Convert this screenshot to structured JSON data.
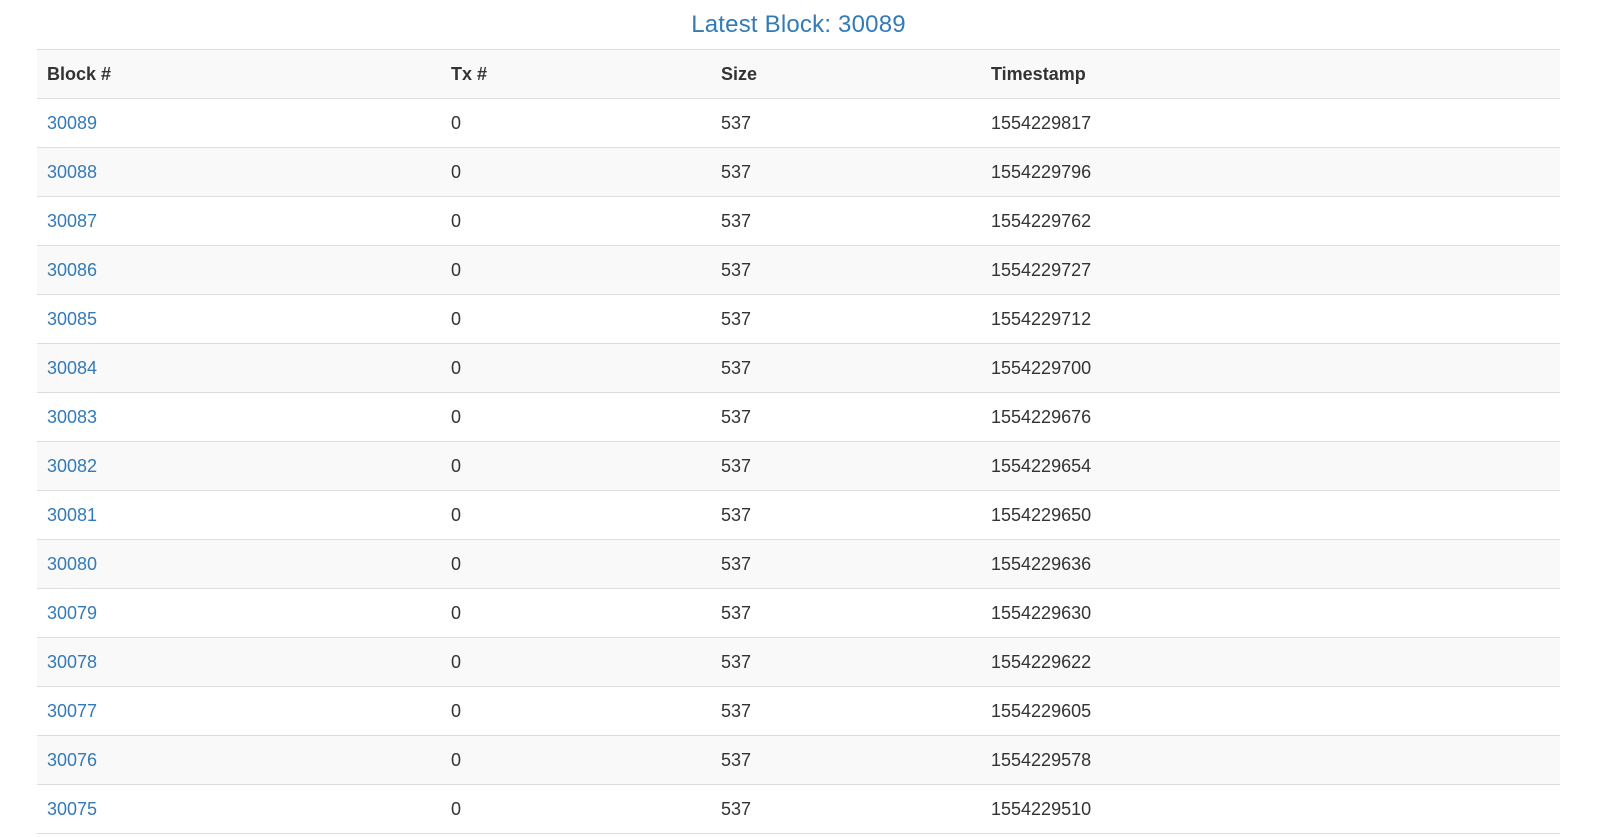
{
  "header": {
    "title": "Latest Block: 30089"
  },
  "colors": {
    "link": "#337ab7",
    "text": "#333333",
    "stripe": "#f9f9f9",
    "border": "#dddddd"
  },
  "table": {
    "columns": [
      "Block #",
      "Tx #",
      "Size",
      "Timestamp"
    ],
    "rows": [
      {
        "block": "30089",
        "tx": "0",
        "size": "537",
        "timestamp": "1554229817"
      },
      {
        "block": "30088",
        "tx": "0",
        "size": "537",
        "timestamp": "1554229796"
      },
      {
        "block": "30087",
        "tx": "0",
        "size": "537",
        "timestamp": "1554229762"
      },
      {
        "block": "30086",
        "tx": "0",
        "size": "537",
        "timestamp": "1554229727"
      },
      {
        "block": "30085",
        "tx": "0",
        "size": "537",
        "timestamp": "1554229712"
      },
      {
        "block": "30084",
        "tx": "0",
        "size": "537",
        "timestamp": "1554229700"
      },
      {
        "block": "30083",
        "tx": "0",
        "size": "537",
        "timestamp": "1554229676"
      },
      {
        "block": "30082",
        "tx": "0",
        "size": "537",
        "timestamp": "1554229654"
      },
      {
        "block": "30081",
        "tx": "0",
        "size": "537",
        "timestamp": "1554229650"
      },
      {
        "block": "30080",
        "tx": "0",
        "size": "537",
        "timestamp": "1554229636"
      },
      {
        "block": "30079",
        "tx": "0",
        "size": "537",
        "timestamp": "1554229630"
      },
      {
        "block": "30078",
        "tx": "0",
        "size": "537",
        "timestamp": "1554229622"
      },
      {
        "block": "30077",
        "tx": "0",
        "size": "537",
        "timestamp": "1554229605"
      },
      {
        "block": "30076",
        "tx": "0",
        "size": "537",
        "timestamp": "1554229578"
      },
      {
        "block": "30075",
        "tx": "0",
        "size": "537",
        "timestamp": "1554229510"
      }
    ]
  }
}
